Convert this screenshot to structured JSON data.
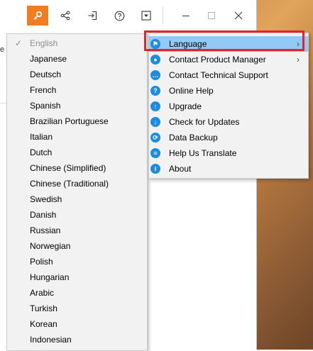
{
  "titlebar": {
    "buttons": [
      "key-icon",
      "share-icon",
      "login-icon",
      "help-icon",
      "menu-dropdown-icon"
    ],
    "window_controls": [
      "minimize-icon",
      "maximize-icon",
      "close-icon"
    ]
  },
  "background_partial_text": "ec",
  "language_menu": {
    "items": [
      {
        "label": "English",
        "checked": true
      },
      {
        "label": "Japanese"
      },
      {
        "label": "Deutsch"
      },
      {
        "label": "French"
      },
      {
        "label": "Spanish"
      },
      {
        "label": "Brazilian Portuguese"
      },
      {
        "label": "Italian"
      },
      {
        "label": "Dutch"
      },
      {
        "label": "Chinese (Simplified)"
      },
      {
        "label": "Chinese (Traditional)"
      },
      {
        "label": "Swedish"
      },
      {
        "label": "Danish"
      },
      {
        "label": "Russian"
      },
      {
        "label": "Norwegian"
      },
      {
        "label": "Polish"
      },
      {
        "label": "Hungarian"
      },
      {
        "label": "Arabic"
      },
      {
        "label": "Turkish"
      },
      {
        "label": "Korean"
      },
      {
        "label": "Indonesian"
      }
    ]
  },
  "main_menu": {
    "items": [
      {
        "label": "Language",
        "icon": "flag-icon",
        "submenu": true,
        "highlighted": true
      },
      {
        "label": "Contact Product Manager",
        "icon": "person-icon",
        "submenu": true
      },
      {
        "label": "Contact Technical Support",
        "icon": "chat-icon",
        "submenu": false
      },
      {
        "label": "Online Help",
        "icon": "question-icon",
        "submenu": false
      },
      {
        "label": "Upgrade",
        "icon": "upgrade-icon",
        "submenu": false
      },
      {
        "label": "Check for Updates",
        "icon": "download-icon",
        "submenu": false
      },
      {
        "label": "Data Backup",
        "icon": "backup-icon",
        "submenu": false
      },
      {
        "label": "Help Us Translate",
        "icon": "translate-icon",
        "submenu": false
      },
      {
        "label": "About",
        "icon": "info-icon",
        "submenu": false
      }
    ]
  },
  "colors": {
    "accent_orange": "#f07d22",
    "menu_highlight": "#91c9f7",
    "icon_blue": "#1c8ce0",
    "annotation_red": "#e2242b"
  }
}
